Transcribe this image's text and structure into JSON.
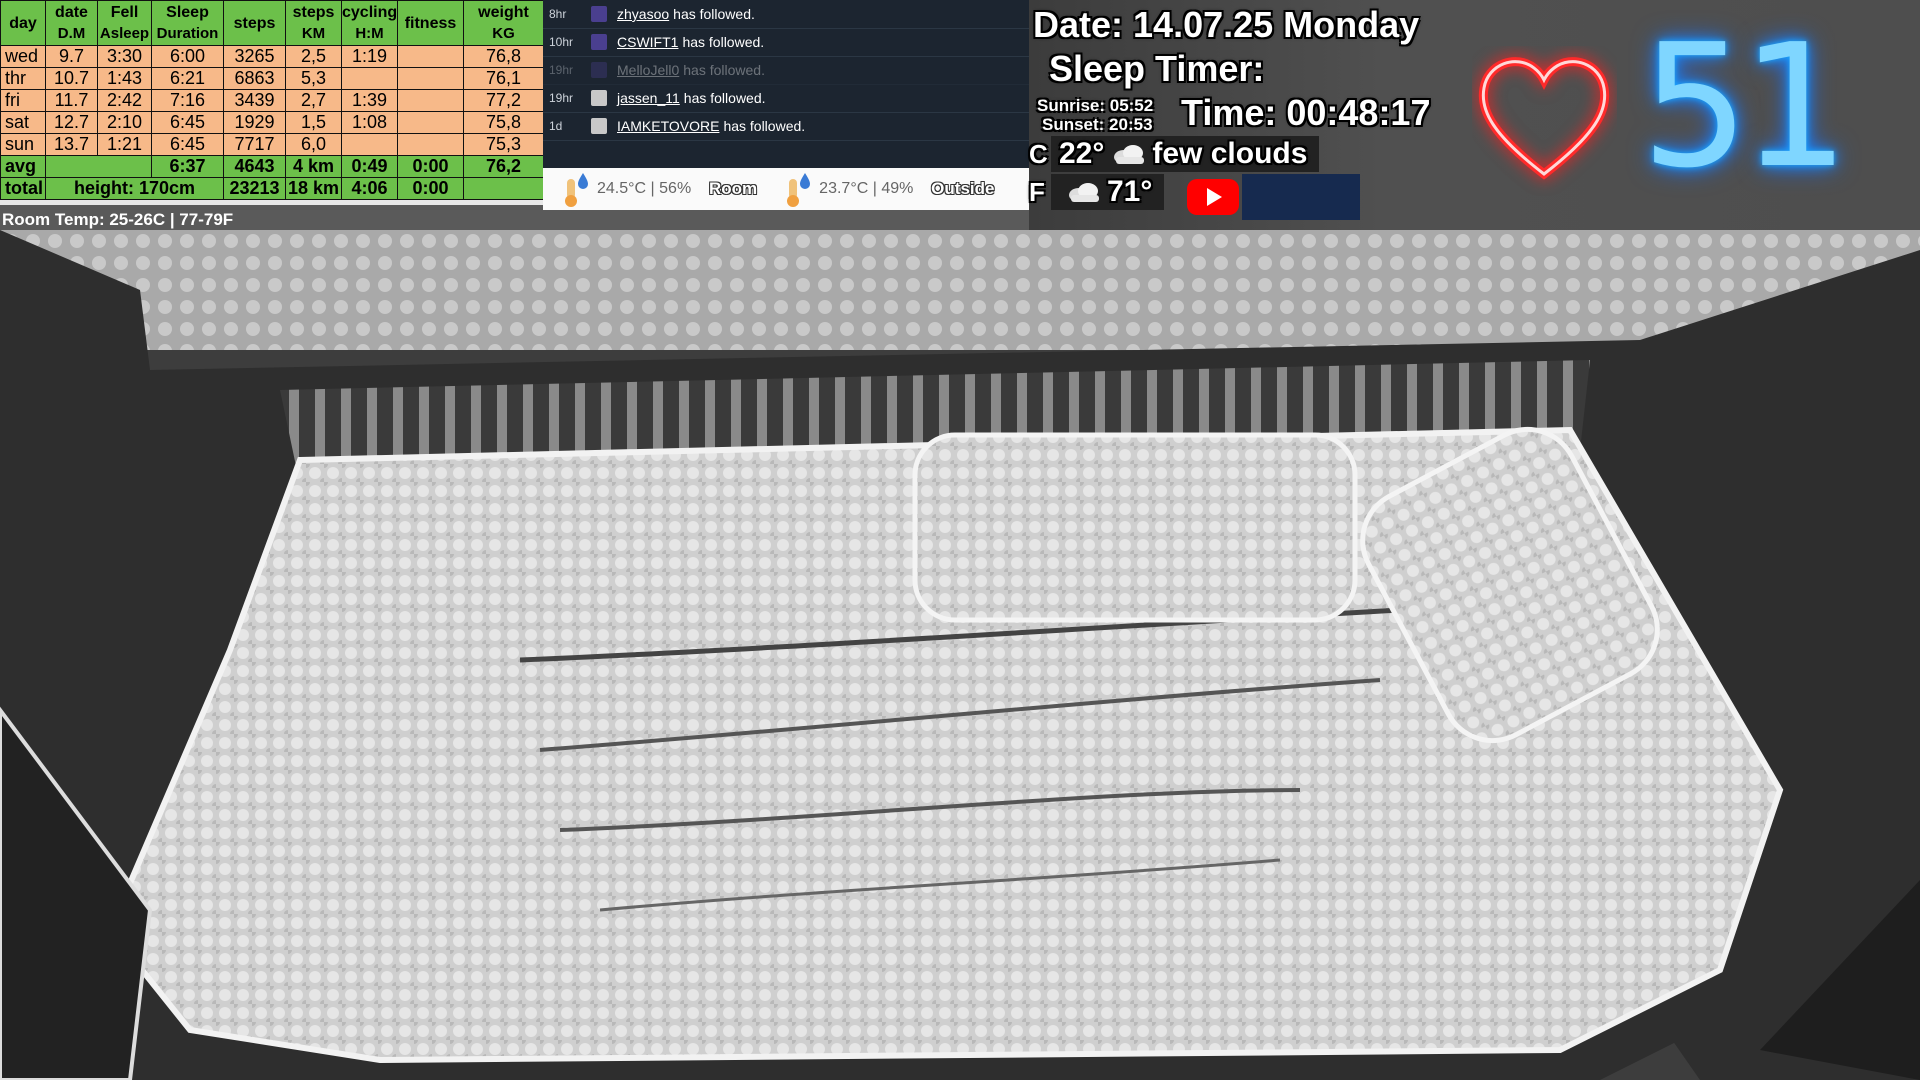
{
  "stats": {
    "headers": [
      [
        "day",
        ""
      ],
      [
        "date",
        "D.M"
      ],
      [
        "Fell",
        "Asleep"
      ],
      [
        "Sleep",
        "Duration"
      ],
      [
        "steps",
        ""
      ],
      [
        "steps",
        "KM"
      ],
      [
        "cycling",
        "H:M"
      ],
      [
        "fitness",
        ""
      ],
      [
        "weight",
        "KG"
      ]
    ],
    "rows": [
      [
        "wed",
        "9.7",
        "3:30",
        "6:00",
        "3265",
        "2,5",
        "1:19",
        "",
        "76,8"
      ],
      [
        "thr",
        "10.7",
        "1:43",
        "6:21",
        "6863",
        "5,3",
        "",
        "",
        "76,1"
      ],
      [
        "fri",
        "11.7",
        "2:42",
        "7:16",
        "3439",
        "2,7",
        "1:39",
        "",
        "77,2"
      ],
      [
        "sat",
        "12.7",
        "2:10",
        "6:45",
        "1929",
        "1,5",
        "1:08",
        "",
        "75,8"
      ],
      [
        "sun",
        "13.7",
        "1:21",
        "6:45",
        "7717",
        "6,0",
        "",
        "",
        "75,3"
      ]
    ],
    "avg": {
      "label": "avg",
      "sleep": "6:37",
      "steps": "4643",
      "km": "4 km",
      "cycling": "0:49",
      "fitness": "0:00",
      "weight": "76,2"
    },
    "total": {
      "label": "total",
      "height": "height: 170cm",
      "steps": "23213",
      "km": "18 km",
      "cycling": "4:06",
      "fitness": "0:00"
    }
  },
  "room_temp": "Room Temp: 25-26C | 77-79F",
  "follows": [
    {
      "age": "8hr",
      "user": "zhyasoo",
      "text": "has followed.",
      "avatar": "#4a3f8f",
      "dim": false
    },
    {
      "age": "10hr",
      "user": "CSWIFT1",
      "text": "has followed.",
      "avatar": "#4a3f8f",
      "dim": false
    },
    {
      "age": "19hr",
      "user": "MelloJell0",
      "text": "has followed.",
      "avatar": "#4a3f8f",
      "dim": true
    },
    {
      "age": "19hr",
      "user": "jassen_11",
      "text": "has followed.",
      "avatar": "#c8c8c8",
      "dim": false
    },
    {
      "age": "1d",
      "user": "IAMKETOVORE",
      "text": "has followed.",
      "avatar": "#c8c8c8",
      "dim": false
    }
  ],
  "temps": {
    "room": "24.5°C | 56%",
    "room_label": "Room",
    "outside": "23.7°C | 49%",
    "outside_label": "Outside"
  },
  "header": {
    "date": "Date: 14.07.25 Monday",
    "sleep_timer": "Sleep Timer:",
    "sunrise": "Sunrise: 05:52",
    "sunset": "Sunset: 20:53",
    "time": "Time: 00:48:17"
  },
  "weather": {
    "c_letter": "C",
    "c_temp": "22°",
    "condition": "few clouds",
    "f_letter": "F",
    "f_temp": "71°"
  },
  "heart_rate": "51",
  "icons": [
    "thermometer-icon",
    "cloud-icon",
    "youtube-icon",
    "heart-icon"
  ],
  "colors": {
    "table_header": "#6cc04a",
    "table_row": "#f7b989",
    "feed_bg": "#1c2530",
    "heart": "#ff3030",
    "heart_rate": "#2aa8ff",
    "youtube": "#ff0000"
  }
}
